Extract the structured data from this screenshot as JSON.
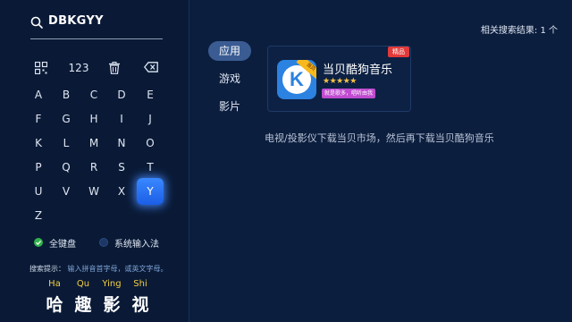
{
  "search": {
    "query": "DBKGYY"
  },
  "keyboard": {
    "function_keys": {
      "number_mode": "123"
    },
    "keys": [
      "A",
      "B",
      "C",
      "D",
      "E",
      "F",
      "G",
      "H",
      "I",
      "J",
      "K",
      "L",
      "M",
      "N",
      "O",
      "P",
      "Q",
      "R",
      "S",
      "T",
      "U",
      "V",
      "W",
      "X",
      "Y",
      "Z"
    ],
    "selected_key": "Y",
    "modes": [
      {
        "label": "全键盘",
        "selected": true,
        "color": "#2fb34a"
      },
      {
        "label": "系统输入法",
        "selected": false,
        "color": "#1d3765"
      }
    ]
  },
  "hint": {
    "label": "搜索提示：",
    "text": "输入拼音首字母，或英文字母。"
  },
  "suggestions": [
    {
      "pinyin": "Ha",
      "hanzi": "哈"
    },
    {
      "pinyin": "Qu",
      "hanzi": "趣"
    },
    {
      "pinyin": "Ying",
      "hanzi": "影"
    },
    {
      "pinyin": "Shi",
      "hanzi": "视"
    }
  ],
  "results": {
    "count_text": "相关搜索结果: 1 个",
    "tabs": [
      {
        "label": "应用",
        "active": true
      },
      {
        "label": "游戏",
        "active": false
      },
      {
        "label": "影片",
        "active": false
      }
    ],
    "app": {
      "name": "当贝酷狗音乐",
      "icon_letter": "K",
      "icon_corner_text": "当贝",
      "rating_stars": 4.5,
      "rating_display": "★★★★★",
      "slogan": "就是歌多，唱听由我",
      "badge": "精品"
    },
    "tip": "电视/投影仪下载当贝市场，然后再下载当贝酷狗音乐"
  },
  "colors": {
    "background": "#0c1e3e",
    "panel": "#0a1a36",
    "accent_blue": "#2f7bff",
    "suggestion_pinyin": "#f4d03f",
    "badge_red": "#e23a3a",
    "slogan_pink": "#c04bd1"
  },
  "icons": {
    "search": "search-icon",
    "qr": "qr-grid-icon",
    "delete": "trash-icon",
    "backspace": "backspace-icon"
  }
}
